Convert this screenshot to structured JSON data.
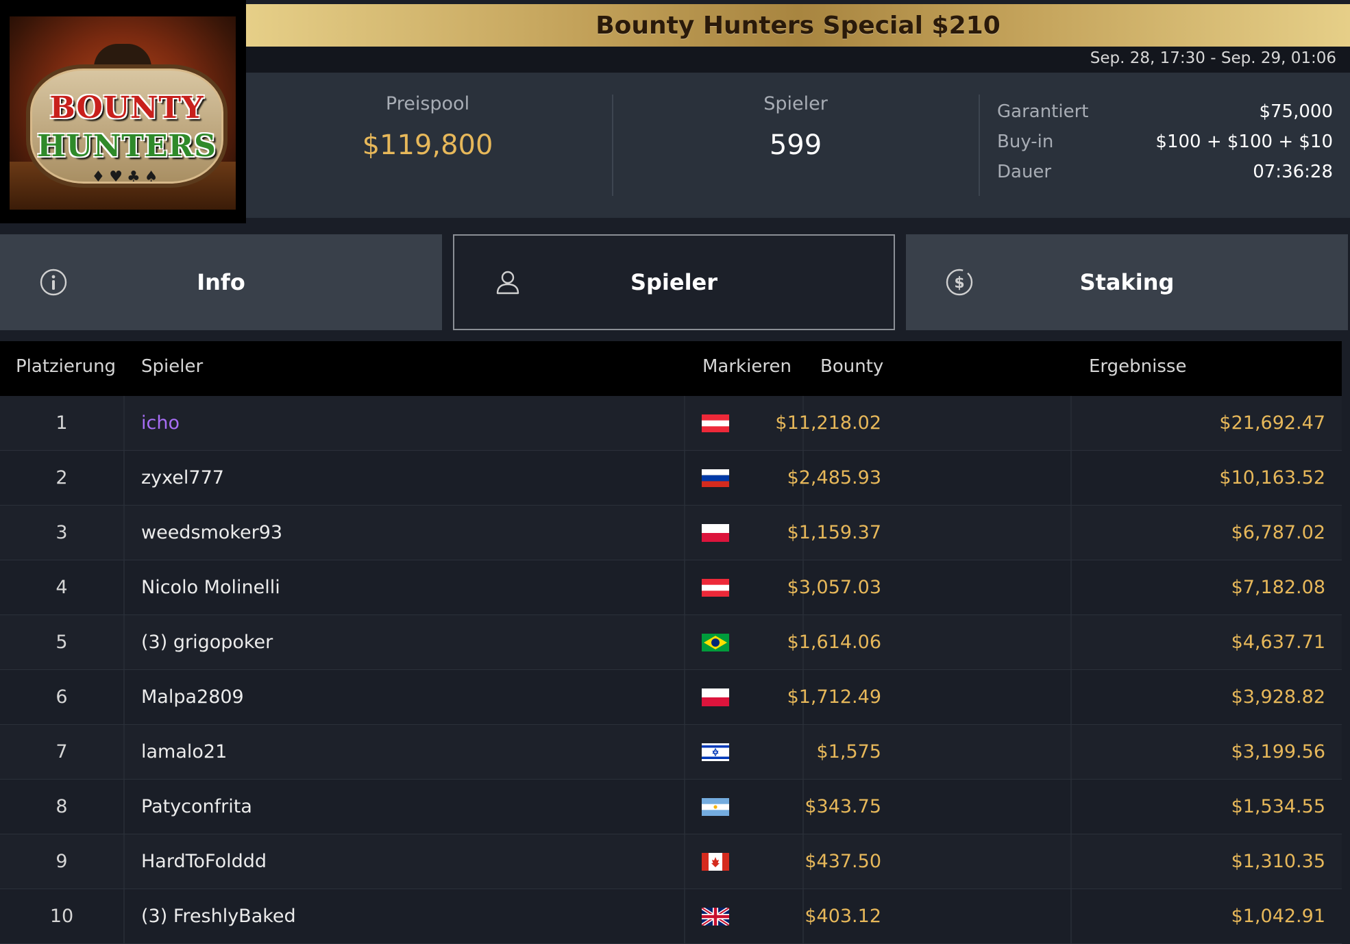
{
  "header": {
    "logo_line1": "BOUNTY",
    "logo_line2": "HUNTERS",
    "title": "Bounty Hunters Special $210",
    "dates": "Sep. 28, 17:30 - Sep. 29, 01:06"
  },
  "stats": {
    "prize_label": "Preispool",
    "prize_value": "$119,800",
    "players_label": "Spieler",
    "players_value": "599",
    "info": [
      {
        "key": "Garantiert",
        "value": "$75,000"
      },
      {
        "key": "Buy-in",
        "value": "$100 + $100 + $10"
      },
      {
        "key": "Dauer",
        "value": "07:36:28"
      }
    ]
  },
  "tabs": [
    {
      "label": "Info",
      "icon": "info-circle-icon",
      "active": false
    },
    {
      "label": "Spieler",
      "icon": "user-icon",
      "active": true
    },
    {
      "label": "Staking",
      "icon": "dollar-coin-icon",
      "active": false
    }
  ],
  "table": {
    "headers": {
      "rank": "Platzierung",
      "player": "Spieler",
      "flag": "Markieren",
      "bounty": "Bounty",
      "result": "Ergebnisse"
    },
    "rows": [
      {
        "rank": "1",
        "player": "icho",
        "flag": "austria",
        "bounty": "$11,218.02",
        "result": "$21,692.47",
        "highlight": true
      },
      {
        "rank": "2",
        "player": "zyxel777",
        "flag": "russia",
        "bounty": "$2,485.93",
        "result": "$10,163.52"
      },
      {
        "rank": "3",
        "player": "weedsmoker93",
        "flag": "poland",
        "bounty": "$1,159.37",
        "result": "$6,787.02"
      },
      {
        "rank": "4",
        "player": "Nicolo Molinelli",
        "flag": "austria",
        "bounty": "$3,057.03",
        "result": "$7,182.08"
      },
      {
        "rank": "5",
        "player": "(3) grigopoker",
        "flag": "brazil",
        "bounty": "$1,614.06",
        "result": "$4,637.71"
      },
      {
        "rank": "6",
        "player": "Malpa2809",
        "flag": "poland",
        "bounty": "$1,712.49",
        "result": "$3,928.82"
      },
      {
        "rank": "7",
        "player": "lamalo21",
        "flag": "israel",
        "bounty": "$1,575",
        "result": "$3,199.56"
      },
      {
        "rank": "8",
        "player": "Patyconfrita",
        "flag": "argentina",
        "bounty": "$343.75",
        "result": "$1,534.55"
      },
      {
        "rank": "9",
        "player": "HardToFolddd",
        "flag": "canada",
        "bounty": "$437.50",
        "result": "$1,310.35"
      },
      {
        "rank": "10",
        "player": "(3) FreshlyBaked",
        "flag": "uk",
        "bounty": "$403.12",
        "result": "$1,042.91"
      }
    ]
  },
  "colors": {
    "gold": "#e7b85a",
    "highlight_player": "#a86ef5",
    "background": "#1a1e27"
  }
}
